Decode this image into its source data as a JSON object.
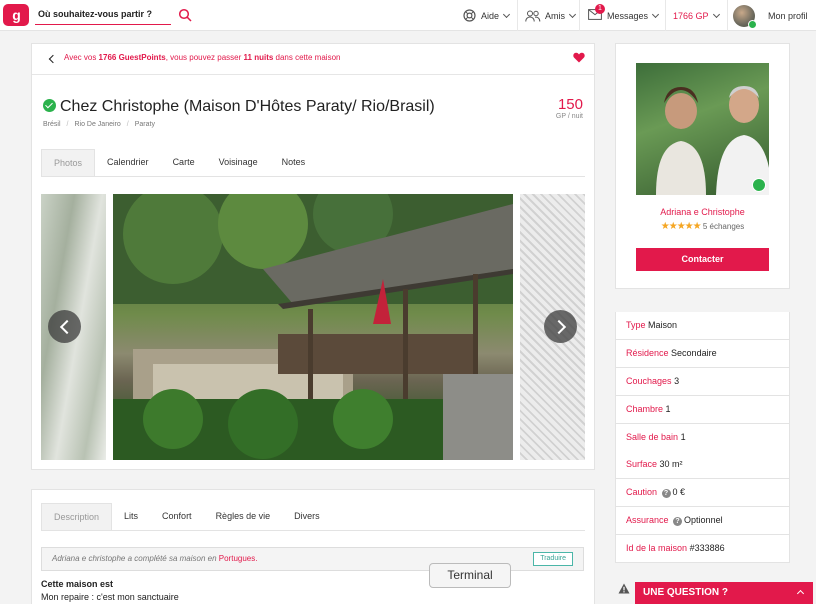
{
  "header": {
    "logo_text": "g",
    "search_placeholder": "Où souhaitez-vous partir ?",
    "nav": {
      "help": "Aide",
      "friends": "Amis",
      "messages": "Messages",
      "messages_badge": "1",
      "points": "1766 GP",
      "profile": "Mon profil"
    }
  },
  "alert": {
    "pre": "Avec vos ",
    "points": "1766 GuestPoints",
    "mid": ", vous pouvez passer ",
    "nights": "11 nuits",
    "post": " dans cette maison"
  },
  "listing": {
    "title": "Chez Christophe (Maison D'Hôtes Paraty/ Rio/Brasil)",
    "breadcrumb": [
      "Brésil",
      "Rio De Janeiro",
      "Paraty"
    ],
    "price_value": "150",
    "price_unit": "GP / nuit",
    "tabs": [
      "Photos",
      "Calendrier",
      "Carte",
      "Voisinage",
      "Notes"
    ]
  },
  "description": {
    "tabs": [
      "Description",
      "Lits",
      "Confort",
      "Règles de vie",
      "Divers"
    ],
    "translate_pre": "Adriana e christophe a complété sa maison en ",
    "translate_lang": "Portugues.",
    "translate_button": "Traduire",
    "heading": "Cette maison est",
    "text": "Mon repaire : c'est mon sanctuaire"
  },
  "host": {
    "name": "Adriana e Christophe",
    "stars": "★★★★★",
    "exchanges": "5 échanges",
    "contact": "Contacter"
  },
  "properties": [
    {
      "key": "Type",
      "value": "Maison"
    },
    {
      "key": "Résidence",
      "value": "Secondaire"
    },
    {
      "key": "Couchages",
      "value": "3"
    },
    {
      "key": "Chambre",
      "value": "1"
    },
    {
      "key": "Salle de bain",
      "value": "1"
    },
    {
      "key": "Surface",
      "value": "30 m²"
    },
    {
      "key": "Caution",
      "value": "0 €"
    },
    {
      "key": "Assurance",
      "value": "Optionnel"
    },
    {
      "key": "Id de la maison",
      "value": "#333886"
    }
  ],
  "question_bar": "UNE QUESTION ?",
  "tooltip": "Terminal",
  "colors": {
    "accent": "#e2194b",
    "verified": "#2bb24c"
  }
}
